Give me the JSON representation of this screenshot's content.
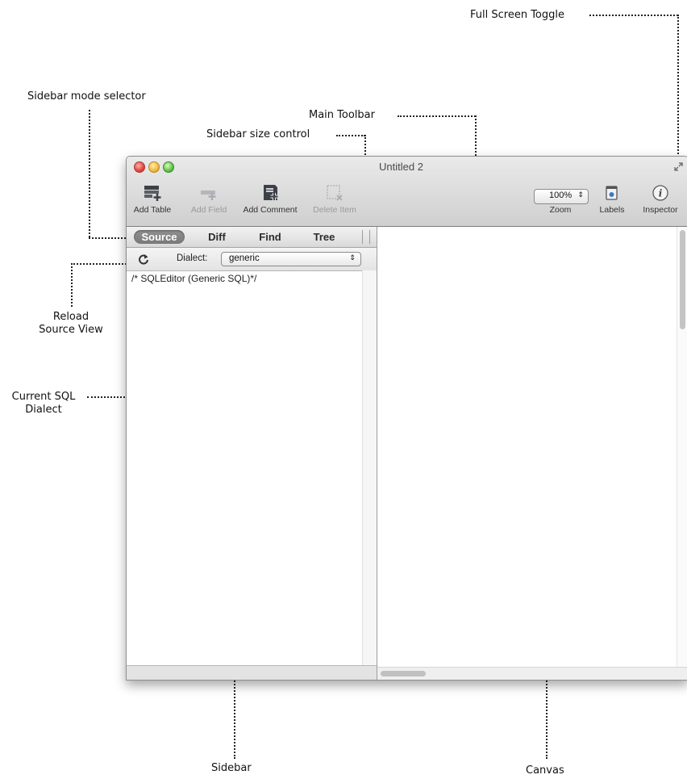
{
  "annotations": {
    "full_screen_toggle": "Full Screen Toggle",
    "sidebar_mode_selector": "Sidebar mode selector",
    "main_toolbar": "Main Toolbar",
    "sidebar_size_control": "Sidebar size control",
    "reload_source_view_line1": "Reload",
    "reload_source_view_line2": "Source View",
    "current_sql_dialect_line1": "Current SQL",
    "current_sql_dialect_line2": "Dialect",
    "sidebar": "Sidebar",
    "canvas": "Canvas"
  },
  "window": {
    "title": "Untitled 2"
  },
  "toolbar": {
    "add_table": "Add Table",
    "add_field": "Add Field",
    "add_comment": "Add Comment",
    "delete_item": "Delete Item",
    "zoom_value": "100%",
    "zoom_label": "Zoom",
    "labels": "Labels",
    "inspector": "Inspector"
  },
  "sidebar": {
    "modes": [
      "Source",
      "Diff",
      "Find",
      "Tree"
    ],
    "active_mode": "Source",
    "dialect_label": "Dialect:",
    "dialect_value": "generic",
    "source_text": "/* SQLEditor (Generic SQL)*/"
  },
  "icons": {
    "reload": "reload-icon",
    "full_screen": "full-screen-icon",
    "add_table": "add-table-icon",
    "add_field": "add-field-icon",
    "add_comment": "add-comment-icon",
    "delete_item": "delete-item-icon",
    "labels": "labels-icon",
    "inspector": "info-icon"
  },
  "colors": {
    "active_mode_bg": "#878787",
    "close": "#e0443a",
    "minimize": "#f3b73d",
    "zoom": "#61c04a"
  }
}
